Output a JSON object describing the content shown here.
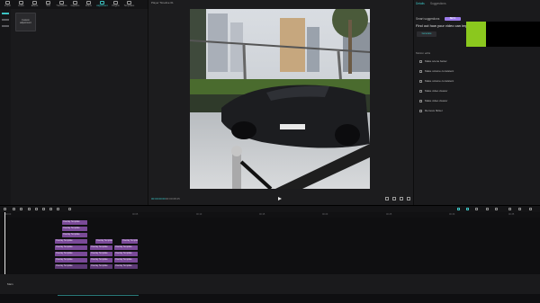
{
  "toolbar": {
    "items": [
      {
        "label": "Import",
        "active": false
      },
      {
        "label": "Audio",
        "active": false
      },
      {
        "label": "Effects",
        "active": false
      },
      {
        "label": "Text",
        "active": false
      },
      {
        "label": "Transitions",
        "active": false
      },
      {
        "label": "Captions",
        "active": false
      },
      {
        "label": "Filters",
        "active": false
      },
      {
        "label": "Adjustment",
        "active": true
      },
      {
        "label": "Plugins",
        "active": false
      },
      {
        "label": "Templates",
        "active": false
      }
    ]
  },
  "left_panel": {
    "custom_card_label": "Custom adjustment"
  },
  "player": {
    "title": "Player  Timeline 01",
    "time_current": "00:00:00:00",
    "time_total": "00:00:08:25"
  },
  "right_panel": {
    "tabs": [
      "Details",
      "Suggestions"
    ],
    "suggestions_title": "Smart suggestions",
    "beta_badge": "BETA",
    "suggestions_subtitle": "Find out how your video can improve",
    "generate_button": "Generate",
    "motion_title": "Motion edits",
    "actions": [
      "Make scene better",
      "Make volume consistent",
      "Make volume consistent",
      "Make video clearer",
      "Make video clearer",
      "Remove flicker"
    ]
  },
  "timeline": {
    "ruler": [
      "00:00",
      "00:05",
      "00:10",
      "00:15",
      "00:20",
      "00:25",
      "00:30",
      "00:35",
      "00:40"
    ],
    "track_label": "Main",
    "clips": [
      {
        "label": "Overlay Template",
        "tone": "normal"
      },
      {
        "label": "Overlay Template",
        "tone": "normal"
      },
      {
        "label": "Overlay Template",
        "tone": "normal"
      },
      {
        "label": "Overlay Template",
        "tone": "normal"
      },
      {
        "label": "Overlay Template",
        "tone": "normal"
      },
      {
        "label": "Overlay Template",
        "tone": "normal"
      },
      {
        "label": "Overlay Template",
        "tone": "normal"
      },
      {
        "label": "Overlay Template",
        "tone": "normal"
      },
      {
        "label": "Overlay Template",
        "tone": "normal"
      },
      {
        "label": "Overlay Template",
        "tone": "normal"
      },
      {
        "label": "Overlay Template",
        "tone": "normal"
      },
      {
        "label": "Overlay Template",
        "tone": "normal"
      },
      {
        "label": "Overlay Template",
        "tone": "normal"
      },
      {
        "label": "Overlay Template",
        "tone": "normal"
      },
      {
        "label": "Overlay Template",
        "tone": "normal"
      },
      {
        "label": "Overlay Template",
        "tone": "normal"
      },
      {
        "label": "Overlay Template",
        "tone": "normal"
      },
      {
        "label": "Overlay Template",
        "tone": "normal"
      }
    ]
  },
  "colors": {
    "accent": "#3cc3c3",
    "clip": "#7a4a98",
    "badge": "#9c7bea"
  }
}
